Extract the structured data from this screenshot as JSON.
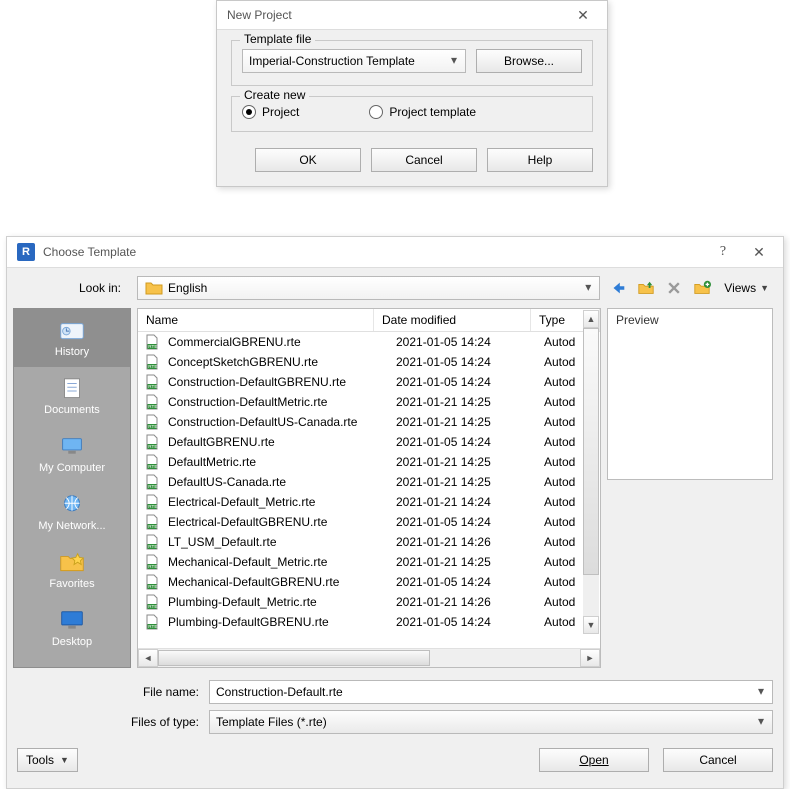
{
  "dlg1": {
    "title": "New Project",
    "group_template_label": "Template file",
    "template_value": "Imperial-Construction Template",
    "browse_label": "Browse...",
    "group_create_label": "Create new",
    "radio_project": "Project",
    "radio_template": "Project template",
    "ok_label": "OK",
    "cancel_label": "Cancel",
    "help_label": "Help"
  },
  "dlg2": {
    "title": "Choose Template",
    "app_letter": "R",
    "lookin_label": "Look in:",
    "lookin_value": "English",
    "views_label": "Views",
    "preview_label": "Preview",
    "headers": {
      "name": "Name",
      "date": "Date modified",
      "type": "Type"
    },
    "sidebar": [
      {
        "id": "history",
        "label": "History"
      },
      {
        "id": "documents",
        "label": "Documents"
      },
      {
        "id": "mycomputer",
        "label": "My Computer"
      },
      {
        "id": "mynetwork",
        "label": "My Network..."
      },
      {
        "id": "favorites",
        "label": "Favorites"
      },
      {
        "id": "desktop",
        "label": "Desktop"
      }
    ],
    "files": [
      {
        "name": "CommercialGBRENU.rte",
        "date": "2021-01-05 14:24",
        "type": "Autod"
      },
      {
        "name": "ConceptSketchGBRENU.rte",
        "date": "2021-01-05 14:24",
        "type": "Autod"
      },
      {
        "name": "Construction-DefaultGBRENU.rte",
        "date": "2021-01-05 14:24",
        "type": "Autod"
      },
      {
        "name": "Construction-DefaultMetric.rte",
        "date": "2021-01-21 14:25",
        "type": "Autod"
      },
      {
        "name": "Construction-DefaultUS-Canada.rte",
        "date": "2021-01-21 14:25",
        "type": "Autod"
      },
      {
        "name": "DefaultGBRENU.rte",
        "date": "2021-01-05 14:24",
        "type": "Autod"
      },
      {
        "name": "DefaultMetric.rte",
        "date": "2021-01-21 14:25",
        "type": "Autod"
      },
      {
        "name": "DefaultUS-Canada.rte",
        "date": "2021-01-21 14:25",
        "type": "Autod"
      },
      {
        "name": "Electrical-Default_Metric.rte",
        "date": "2021-01-21 14:24",
        "type": "Autod"
      },
      {
        "name": "Electrical-DefaultGBRENU.rte",
        "date": "2021-01-05 14:24",
        "type": "Autod"
      },
      {
        "name": "LT_USM_Default.rte",
        "date": "2021-01-21 14:26",
        "type": "Autod"
      },
      {
        "name": "Mechanical-Default_Metric.rte",
        "date": "2021-01-21 14:25",
        "type": "Autod"
      },
      {
        "name": "Mechanical-DefaultGBRENU.rte",
        "date": "2021-01-05 14:24",
        "type": "Autod"
      },
      {
        "name": "Plumbing-Default_Metric.rte",
        "date": "2021-01-21 14:26",
        "type": "Autod"
      },
      {
        "name": "Plumbing-DefaultGBRENU.rte",
        "date": "2021-01-05 14:24",
        "type": "Autod"
      }
    ],
    "filename_label": "File name:",
    "filename_value": "Construction-Default.rte",
    "filetype_label": "Files of type:",
    "filetype_value": "Template Files  (*.rte)",
    "tools_label": "Tools",
    "open_label": "Open",
    "cancel_label": "Cancel"
  }
}
